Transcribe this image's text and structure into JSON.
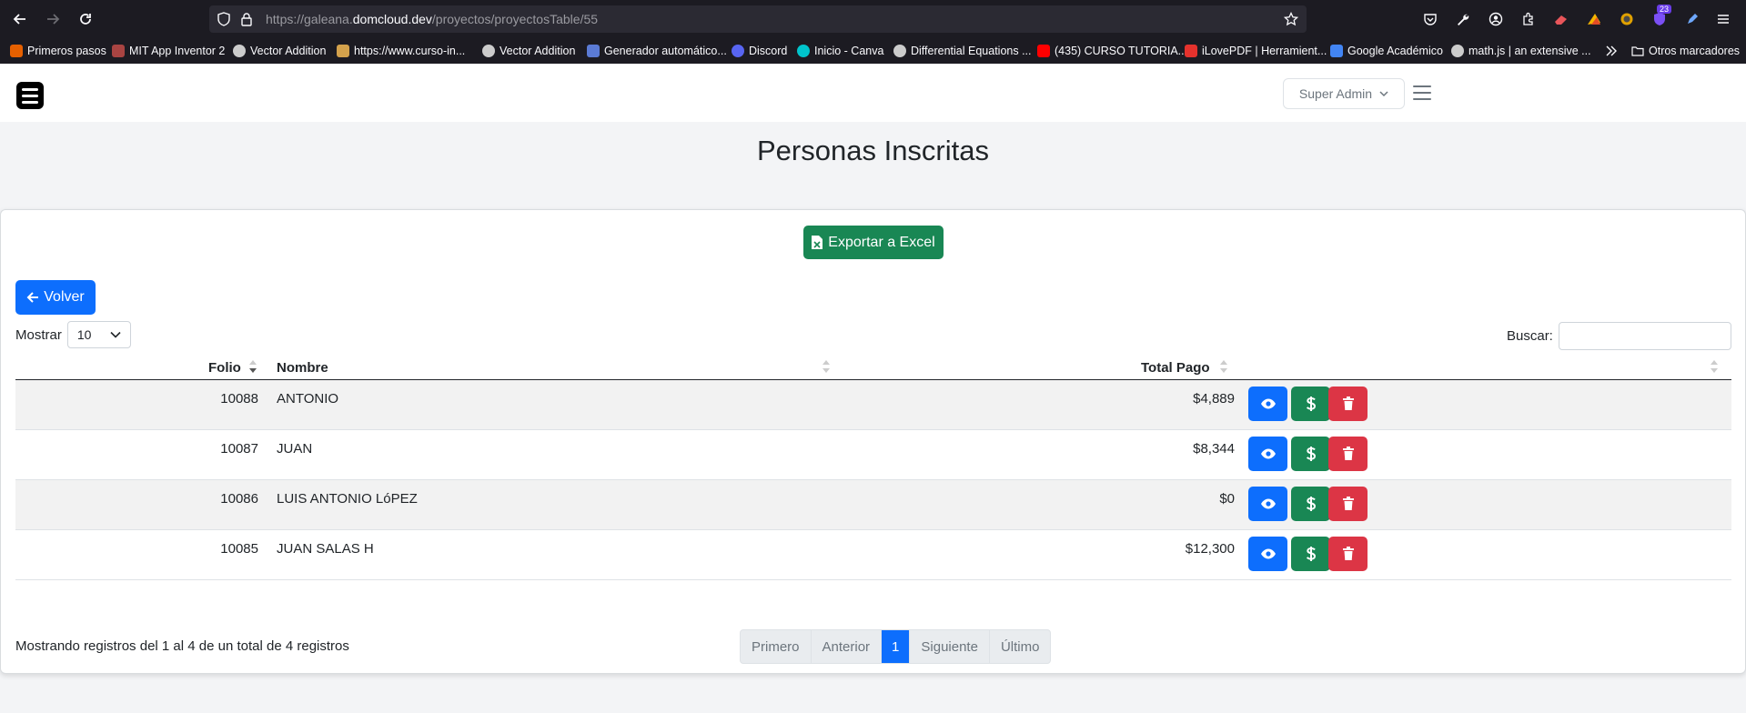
{
  "browser": {
    "url_prefix": "https://galeana.",
    "url_domain": "domcloud.dev",
    "url_path": "/proyectos/proyectosTable/55",
    "extension_badge": "23",
    "bookmarks": [
      {
        "label": "Primeros pasos",
        "color": "#e66000"
      },
      {
        "label": "MIT App Inventor 2",
        "color": "#a94442"
      },
      {
        "label": "Vector Addition",
        "color": "#cccccc"
      },
      {
        "label": "https://www.curso-in...",
        "color": "#d4a24c"
      },
      {
        "label": "Vector Addition",
        "color": "#cccccc"
      },
      {
        "label": "Generador automático...",
        "color": "#5b7bd5"
      },
      {
        "label": "Discord",
        "color": "#5865f2"
      },
      {
        "label": "Inicio - Canva",
        "color": "#00c4cc"
      },
      {
        "label": "Differential Equations ...",
        "color": "#cccccc"
      },
      {
        "label": "(435) CURSO TUTORIA...",
        "color": "#ff0000"
      },
      {
        "label": "iLovePDF | Herramient...",
        "color": "#e5322d"
      },
      {
        "label": "Google Académico",
        "color": "#4285f4"
      },
      {
        "label": "math.js | an extensive ...",
        "color": "#cccccc"
      }
    ],
    "other_bookmarks": "Otros marcadores"
  },
  "header": {
    "user_menu": "Super Admin"
  },
  "page": {
    "title": "Personas Inscritas",
    "export_button": "Exportar a Excel",
    "back_button": "Volver",
    "show_label": "Mostrar",
    "show_value": "10",
    "search_label": "Buscar:",
    "search_value": ""
  },
  "table": {
    "columns": [
      "Folio",
      "Nombre",
      "Total Pago",
      ""
    ],
    "rows": [
      {
        "folio": "10088",
        "nombre": "ANTONIO",
        "total": "$4,889"
      },
      {
        "folio": "10087",
        "nombre": "JUAN",
        "total": "$8,344"
      },
      {
        "folio": "10086",
        "nombre": "LUIS ANTONIO LóPEZ",
        "total": "$0"
      },
      {
        "folio": "10085",
        "nombre": "JUAN SALAS H",
        "total": "$12,300"
      }
    ]
  },
  "footer": {
    "info": "Mostrando registros del 1 al 4 de un total de 4 registros",
    "pagination": [
      "Primero",
      "Anterior",
      "1",
      "Siguiente",
      "Último"
    ]
  },
  "colors": {
    "primary": "#0d6efd",
    "success": "#198754",
    "danger": "#dc3545"
  }
}
